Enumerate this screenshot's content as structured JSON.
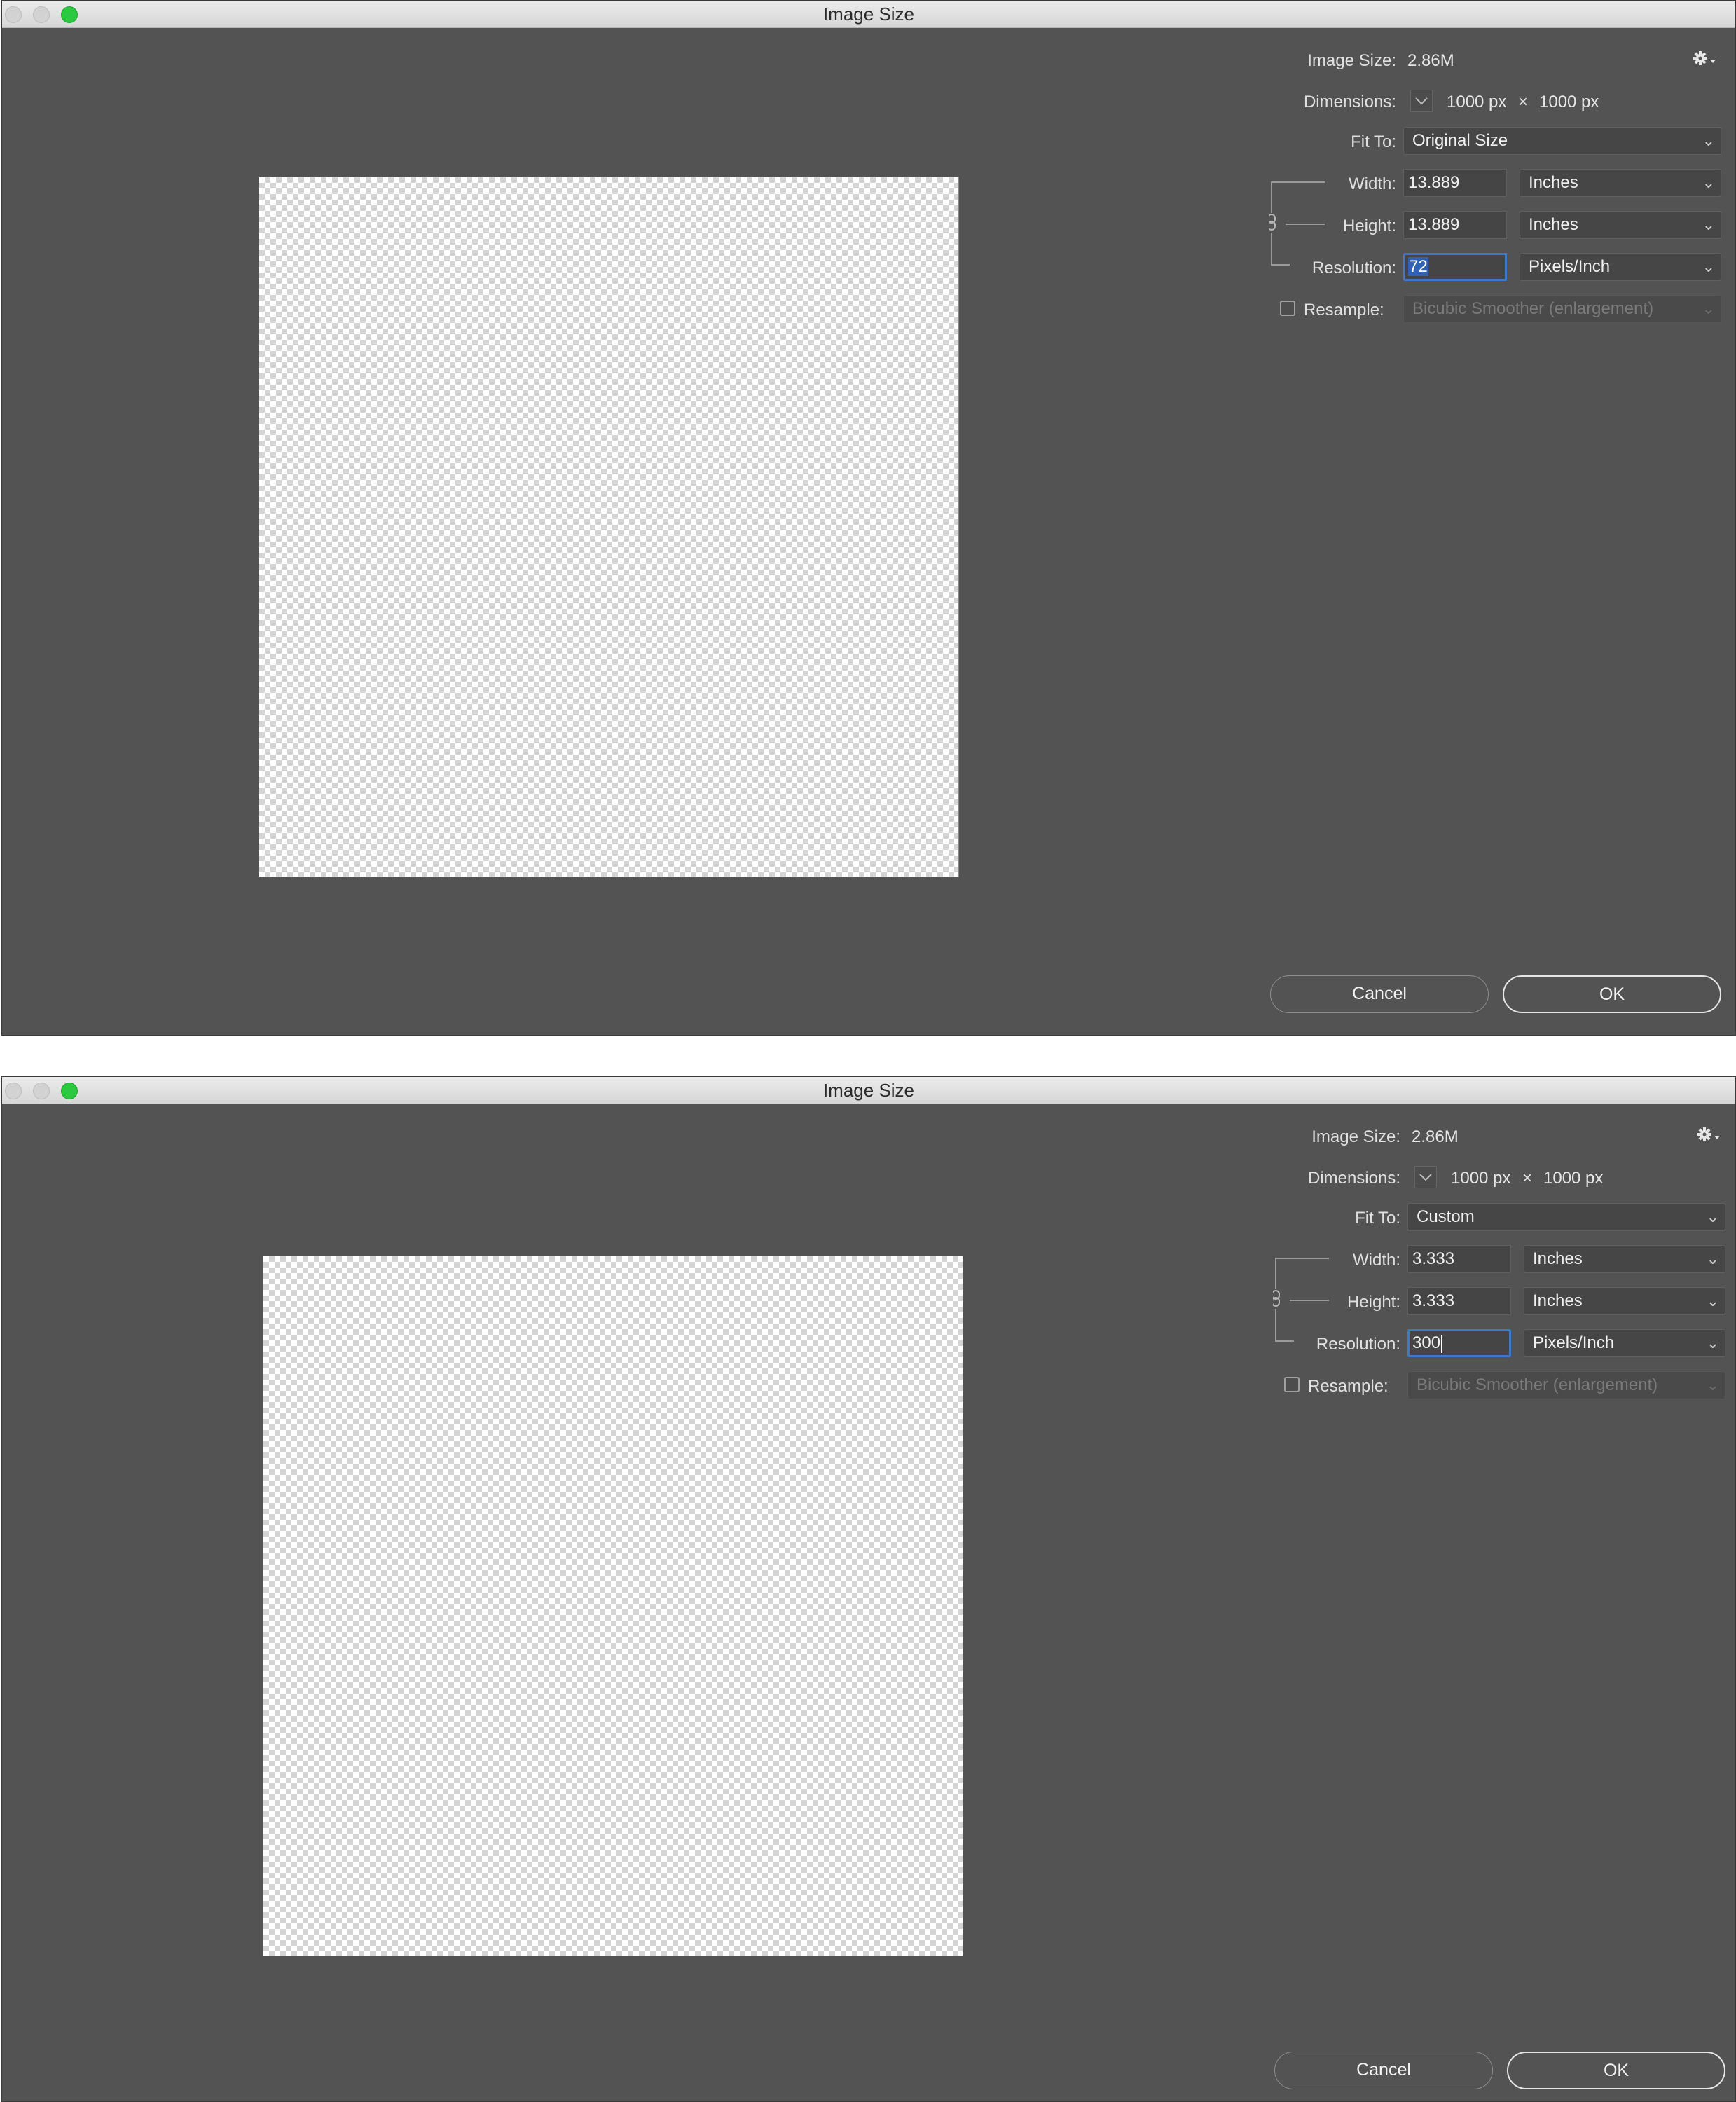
{
  "dialogs": [
    {
      "title": "Image Size",
      "image_size_label": "Image Size:",
      "image_size_value": "2.86M",
      "dimensions_label": "Dimensions:",
      "dim_width": "1000 px",
      "dim_times": "×",
      "dim_height": "1000 px",
      "fit_to_label": "Fit To:",
      "fit_to_value": "Original Size",
      "width_label": "Width:",
      "width_value": "13.889",
      "width_unit": "Inches",
      "height_label": "Height:",
      "height_value": "13.889",
      "height_unit": "Inches",
      "resolution_label": "Resolution:",
      "resolution_value": "72",
      "resolution_unit": "Pixels/Inch",
      "resample_label": "Resample:",
      "resample_checked": false,
      "resample_value": "Bicubic Smoother (enlargement)",
      "cancel_label": "Cancel",
      "ok_label": "OK"
    },
    {
      "title": "Image Size",
      "image_size_label": "Image Size:",
      "image_size_value": "2.86M",
      "dimensions_label": "Dimensions:",
      "dim_width": "1000 px",
      "dim_times": "×",
      "dim_height": "1000 px",
      "fit_to_label": "Fit To:",
      "fit_to_value": "Custom",
      "width_label": "Width:",
      "width_value": "3.333",
      "width_unit": "Inches",
      "height_label": "Height:",
      "height_value": "3.333",
      "height_unit": "Inches",
      "resolution_label": "Resolution:",
      "resolution_value": "300",
      "resolution_unit": "Pixels/Inch",
      "resample_label": "Resample:",
      "resample_checked": false,
      "resample_value": "Bicubic Smoother (enlargement)",
      "cancel_label": "Cancel",
      "ok_label": "OK"
    }
  ],
  "icons": {
    "settings": "gear-icon",
    "link": "chain-link-icon",
    "dropdown": "chevron-down-icon"
  },
  "colors": {
    "dialog_bg": "#535353",
    "titlebar": "#e3e3e3",
    "focus_ring": "#3f78c9",
    "selection": "#2f62b5",
    "zoom_button": "#2ac93f"
  }
}
